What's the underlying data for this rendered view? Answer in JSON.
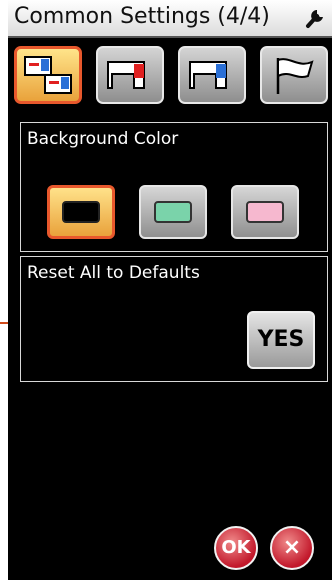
{
  "header": {
    "title": "Common Settings (4/4)",
    "settings_icon": "wrench-icon"
  },
  "tabs": [
    {
      "icon": "machine-pair-icon",
      "active": true
    },
    {
      "icon": "machine-red-icon",
      "active": false
    },
    {
      "icon": "machine-blue-icon",
      "active": false
    },
    {
      "icon": "flag-icon",
      "active": false
    }
  ],
  "background_color": {
    "label": "Background Color",
    "options": [
      {
        "color": "#000000",
        "selected": true
      },
      {
        "color": "#7ad3aa",
        "selected": false
      },
      {
        "color": "#f6b8cf",
        "selected": false
      }
    ]
  },
  "reset": {
    "label": "Reset All to Defaults",
    "button_label": "YES"
  },
  "footer": {
    "ok_label": "OK",
    "cancel_label": "×"
  },
  "colors": {
    "accent_border": "#e8582c",
    "ok_red": "#c2182b"
  }
}
